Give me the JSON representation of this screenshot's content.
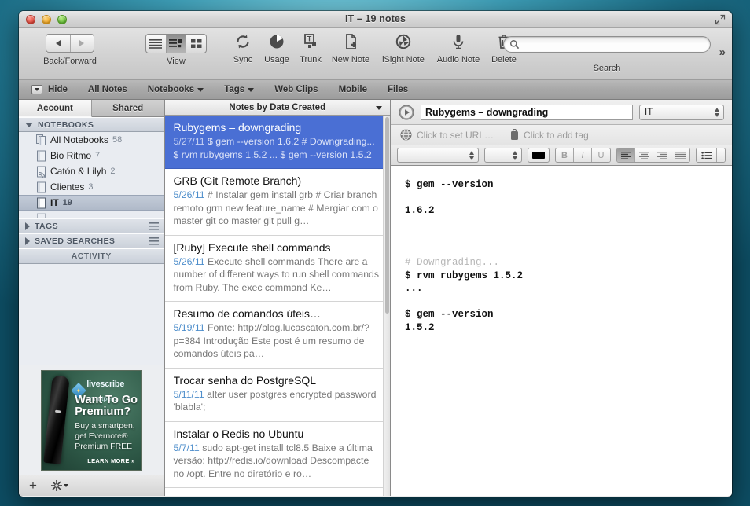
{
  "window": {
    "title": "IT – 19 notes",
    "buttons": {
      "close": "close-button",
      "minimize": "minimize-button",
      "zoom": "zoom-button"
    },
    "fullscreen_label": "Full Screen"
  },
  "toolbar": {
    "back_forward_label": "Back/Forward",
    "view_label": "View",
    "items": [
      {
        "label": "Sync",
        "icon": "sync-icon"
      },
      {
        "label": "Usage",
        "icon": "usage-icon"
      },
      {
        "label": "Trunk",
        "icon": "trunk-icon"
      },
      {
        "label": "New Note",
        "icon": "new-note-icon"
      },
      {
        "label": "iSight Note",
        "icon": "isight-note-icon"
      },
      {
        "label": "Audio Note",
        "icon": "audio-note-icon"
      },
      {
        "label": "Delete",
        "icon": "delete-icon"
      }
    ],
    "search": {
      "label": "Search",
      "value": "",
      "placeholder": ""
    },
    "overflow": "»"
  },
  "filterbar": {
    "hide_label": "Hide",
    "items": [
      {
        "label": "All Notes",
        "has_menu": false
      },
      {
        "label": "Notebooks",
        "has_menu": true
      },
      {
        "label": "Tags",
        "has_menu": true
      },
      {
        "label": "Web Clips",
        "has_menu": false
      },
      {
        "label": "Mobile",
        "has_menu": false
      },
      {
        "label": "Files",
        "has_menu": false
      }
    ]
  },
  "sidebar": {
    "tabs": [
      {
        "label": "Account",
        "selected": true
      },
      {
        "label": "Shared",
        "selected": false
      }
    ],
    "notebooks_header": "NOTEBOOKS",
    "notebooks": [
      {
        "label": "All Notebooks",
        "count": "58",
        "icon": "stacked-notebooks-icon",
        "selected": false
      },
      {
        "label": "Bio Ritmo",
        "count": "7",
        "icon": "notebook-icon",
        "selected": false
      },
      {
        "label": "Catón & Lilyh",
        "count": "2",
        "icon": "shared-notebook-icon",
        "selected": false
      },
      {
        "label": "Clientes",
        "count": "3",
        "icon": "notebook-icon",
        "selected": false
      },
      {
        "label": "IT",
        "count": "19",
        "icon": "notebook-icon",
        "selected": true
      }
    ],
    "tags_header": "TAGS",
    "saved_searches_header": "SAVED SEARCHES",
    "activity_header": "ACTIVITY",
    "ad": {
      "brand": "livescribe",
      "brand_sub": "smartpens",
      "headline": "Want To Go Premium?",
      "body": "Buy a smartpen, get Evernote® Premium FREE",
      "cta": "LEARN MORE »"
    },
    "bottom": {
      "add_label": "+",
      "settings_label": "gear-menu"
    }
  },
  "notelist": {
    "sort_header": "Notes by Date Created",
    "notes": [
      {
        "title": "Rubygems – downgrading",
        "date": "5/27/11",
        "snippet": "$ gem --version 1.6.2 # Downgrading... $ rvm rubygems 1.5.2 ... $ gem --version 1.5.2",
        "selected": true
      },
      {
        "title": "GRB (Git Remote Branch)",
        "date": "5/26/11",
        "snippet": "# Instalar gem install grb # Criar branch remoto grm new feature_name # Mergiar com o master git co master git pull g…",
        "selected": false
      },
      {
        "title": "[Ruby] Execute shell commands",
        "date": "5/26/11",
        "snippet": "Execute shell commands There are a number of different ways to run shell commands from Ruby. The exec command Ke…",
        "selected": false
      },
      {
        "title": "Resumo de comandos úteis…",
        "date": "5/19/11",
        "snippet": "Fonte: http://blog.lucascaton.com.br/?p=384 Introdução Este post é um resumo de comandos úteis pa…",
        "selected": false
      },
      {
        "title": "Trocar senha do PostgreSQL",
        "date": "5/11/11",
        "snippet": "alter user postgres encrypted password 'blabla';",
        "selected": false
      },
      {
        "title": "Instalar o Redis no Ubuntu",
        "date": "5/7/11",
        "snippet": "sudo apt-get install tcl8.5 Baixe a última versão: http://redis.io/download Descompacte no /opt. Entre no diretório e ro…",
        "selected": false
      }
    ]
  },
  "editor": {
    "title_value": "Rubygems – downgrading",
    "notebook_value": "IT",
    "url_placeholder": "Click to set URL…",
    "tag_placeholder": "Click to add tag",
    "format": {
      "font_value": "",
      "size_value": "",
      "bold": "B",
      "italic": "I",
      "underline": "U",
      "color_hex": "#000000",
      "align_left": "align-left",
      "align_center": "align-center",
      "align_right": "align-right",
      "align_justify": "align-justify",
      "list": "bulleted-list"
    },
    "body_lines": [
      {
        "text": "$ gem --version",
        "style": "code"
      },
      {
        "text": "",
        "style": "blank"
      },
      {
        "text": "1.6.2",
        "style": "code"
      },
      {
        "text": "",
        "style": "blank"
      },
      {
        "text": "",
        "style": "blank"
      },
      {
        "text": "",
        "style": "blank"
      },
      {
        "text": "# Downgrading...",
        "style": "comment"
      },
      {
        "text": "$ rvm rubygems 1.5.2",
        "style": "code"
      },
      {
        "text": "...",
        "style": "code"
      },
      {
        "text": "",
        "style": "blank"
      },
      {
        "text": "$ gem --version",
        "style": "code"
      },
      {
        "text": "1.5.2",
        "style": "code"
      }
    ]
  },
  "colors": {
    "selection_blue": "#4a6fd4",
    "date_blue": "#4e8ecb",
    "desktop_teal": "#2d93ad"
  }
}
